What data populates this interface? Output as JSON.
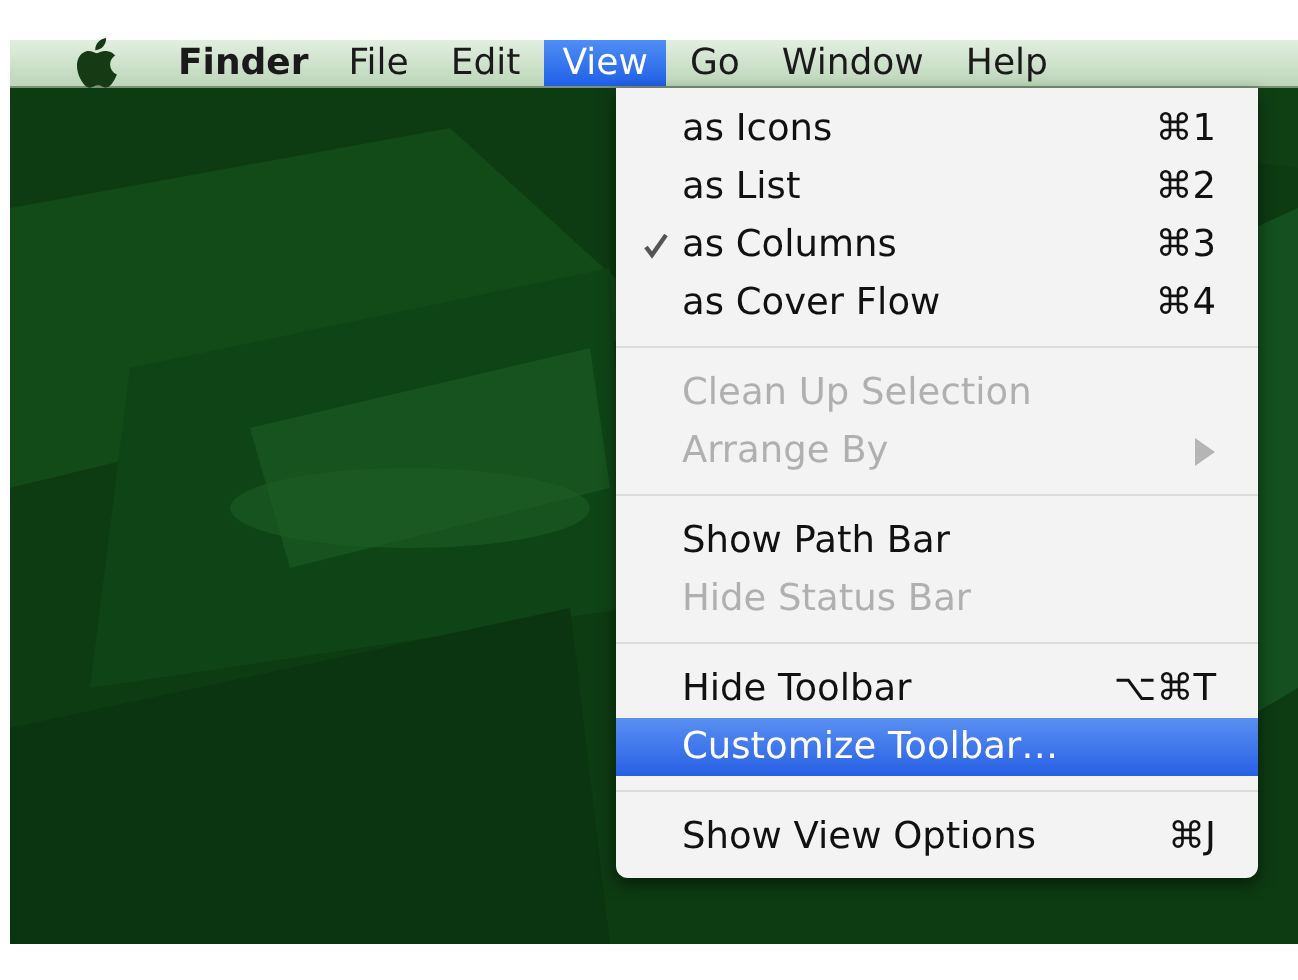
{
  "menu_bar": {
    "items": [
      {
        "label": "Finder",
        "kind": "app",
        "selected": false
      },
      {
        "label": "File",
        "kind": "menu",
        "selected": false
      },
      {
        "label": "Edit",
        "kind": "menu",
        "selected": false
      },
      {
        "label": "View",
        "kind": "menu",
        "selected": true
      },
      {
        "label": "Go",
        "kind": "menu",
        "selected": false
      },
      {
        "label": "Window",
        "kind": "menu",
        "selected": false
      },
      {
        "label": "Help",
        "kind": "menu",
        "selected": false
      }
    ]
  },
  "menu": {
    "groups": [
      [
        {
          "label": "as Icons",
          "shortcut": "⌘1",
          "checked": false,
          "disabled": false,
          "selected": false
        },
        {
          "label": "as List",
          "shortcut": "⌘2",
          "checked": false,
          "disabled": false,
          "selected": false
        },
        {
          "label": "as Columns",
          "shortcut": "⌘3",
          "checked": true,
          "disabled": false,
          "selected": false
        },
        {
          "label": "as Cover Flow",
          "shortcut": "⌘4",
          "checked": false,
          "disabled": false,
          "selected": false
        }
      ],
      [
        {
          "label": "Clean Up Selection",
          "checked": false,
          "disabled": true,
          "selected": false
        },
        {
          "label": "Arrange By",
          "checked": false,
          "disabled": true,
          "selected": false,
          "submenu": true
        }
      ],
      [
        {
          "label": "Show Path Bar",
          "checked": false,
          "disabled": false,
          "selected": false
        },
        {
          "label": "Hide Status Bar",
          "checked": false,
          "disabled": true,
          "selected": false
        }
      ],
      [
        {
          "label": "Hide Toolbar",
          "shortcut": "⌥⌘T",
          "checked": false,
          "disabled": false,
          "selected": false
        },
        {
          "label": "Customize Toolbar…",
          "checked": false,
          "disabled": false,
          "selected": true
        }
      ],
      [
        {
          "label": "Show View Options",
          "shortcut": "⌘J",
          "checked": false,
          "disabled": false,
          "selected": false
        }
      ]
    ]
  }
}
